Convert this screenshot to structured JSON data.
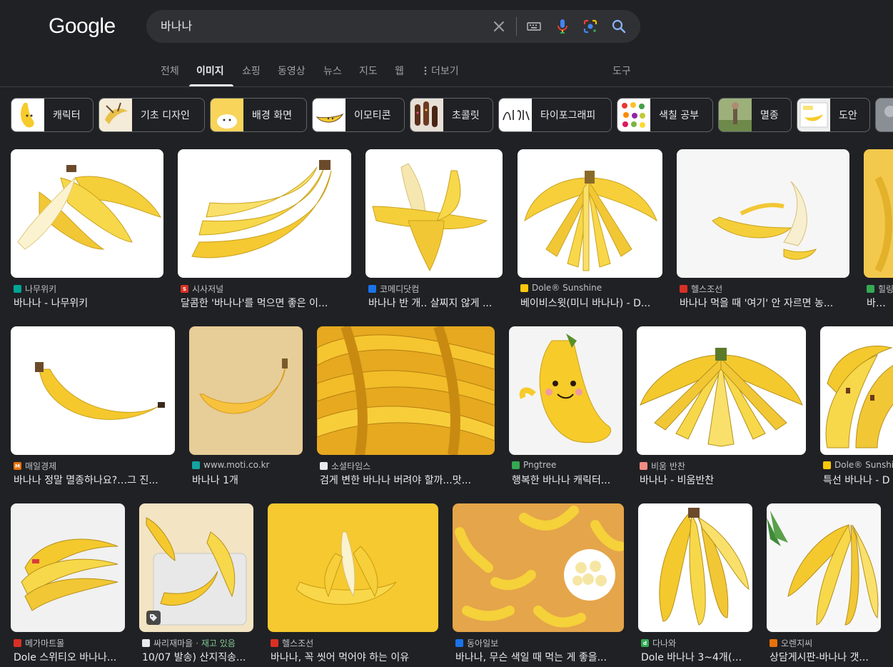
{
  "header": {
    "logo": "Google",
    "search": {
      "value": "바나나",
      "placeholder": ""
    },
    "icons": [
      "close-icon",
      "keyboard-icon",
      "mic-icon",
      "lens-icon",
      "search-icon"
    ]
  },
  "tabs": [
    {
      "label": "전체"
    },
    {
      "label": "이미지",
      "active": true
    },
    {
      "label": "쇼핑"
    },
    {
      "label": "동영상"
    },
    {
      "label": "뉴스"
    },
    {
      "label": "지도"
    },
    {
      "label": "웹"
    },
    {
      "label": "더보기"
    }
  ],
  "tools_label": "도구",
  "chips": [
    {
      "label": "캐릭터"
    },
    {
      "label": "기초 디자인"
    },
    {
      "label": "배경 화면"
    },
    {
      "label": "이모티콘"
    },
    {
      "label": "초콜릿"
    },
    {
      "label": "타이포그래피"
    },
    {
      "label": "색칠 공부"
    },
    {
      "label": "멸종"
    },
    {
      "label": "도안"
    }
  ],
  "results": {
    "row1": [
      {
        "source": "나무위키",
        "title": "바나나 - 나무위키",
        "fav_color": "#00a495"
      },
      {
        "source": "시사저널",
        "title": "달콤한 '바나나'를 먹으면 좋은 이...",
        "fav_color": "#d93025"
      },
      {
        "source": "코메디닷컴",
        "title": "바나나 반 개.. 살찌지 않게 ...",
        "fav_color": "#1a73e8"
      },
      {
        "source": "Dole® Sunshine",
        "title": "베이비스윗(미니 바나나) - D...",
        "fav_color": "#f9c70c"
      },
      {
        "source": "헬스조선",
        "title": "바나나 먹을 때 '여기' 안 자르면 농...",
        "fav_color": "#d93025"
      },
      {
        "source": "힐링",
        "title": "바나나",
        "fav_color": "#34a853"
      }
    ],
    "row2": [
      {
        "source": "매일경제",
        "title": "바나나 정말 멸종하나요?…그 진...",
        "fav_color": "#e8710a"
      },
      {
        "source": "www.moti.co.kr",
        "title": "바나나 1개",
        "fav_color": "#12a4a0"
      },
      {
        "source": "소셜타임스",
        "title": "검게 변한 바나나 버려야 할까...맛...",
        "fav_color": "#e8eaed"
      },
      {
        "source": "Pngtree",
        "title": "행복한 바나나 캐릭터...",
        "fav_color": "#34a853"
      },
      {
        "source": "비움 반찬",
        "title": "바나나 - 비움반찬",
        "fav_color": "#f28b82"
      },
      {
        "source": "Dole® Sunshine",
        "title": "특선 바나나 - D",
        "fav_color": "#f9c70c"
      }
    ],
    "row3": [
      {
        "source": "메가마트몰",
        "title": "Dole 스위티오 바나나...",
        "fav_color": "#d93025"
      },
      {
        "source": "싸리재마을",
        "stock": "· 재고 있음",
        "title": "10/07 발송) 산지직송...",
        "fav_color": "#e8eaed"
      },
      {
        "source": "헬스조선",
        "title": "바나나, 꼭 씻어 먹어야 하는 이유",
        "fav_color": "#d93025"
      },
      {
        "source": "동아일보",
        "title": "바나나, 무슨 색일 때 먹는 게 좋을...",
        "fav_color": "#1a73e8"
      },
      {
        "source": "다나와",
        "title": "Dole 바나나 3~4개(송...",
        "fav_color": "#34a853"
      },
      {
        "source": "오렌지씨",
        "title": "상담게시판-바나나 갯...",
        "fav_color": "#e8710a"
      }
    ]
  }
}
